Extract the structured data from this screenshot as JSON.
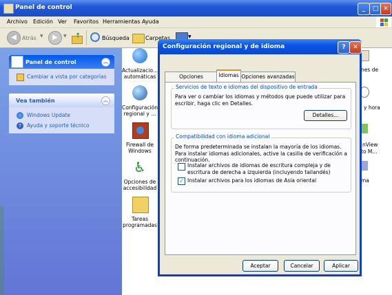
{
  "main_window": {
    "title": "Panel de control",
    "menu": [
      "Archivo",
      "Edición",
      "Ver",
      "Favoritos",
      "Herramientas",
      "Ayuda"
    ],
    "toolbar": {
      "back_label": "Atrás",
      "search_label": "Búsqueda",
      "folders_label": "Carpetas"
    }
  },
  "left_panel": {
    "control_panel_box": {
      "title": "Panel de control",
      "link": "Cambiar a vista por categorías"
    },
    "see_also_box": {
      "title": "Vea también",
      "links": [
        "Windows Update",
        "Ayuda y soporte técnico"
      ]
    }
  },
  "content_icons": [
    {
      "label": "Actualizacio... automáticas",
      "icon": "globe-update-icon"
    },
    {
      "label": "Configuración regional y ...",
      "icon": "globe-clock-icon"
    },
    {
      "label": "Firewall de Windows",
      "icon": "firewall-icon"
    },
    {
      "label": "Opciones de accesibilidad",
      "icon": "accessibility-icon"
    },
    {
      "label": "Tareas programadas",
      "icon": "scheduled-tasks-icon"
    }
  ],
  "right_partial_icons": [
    "nes de",
    "y hora",
    "nView",
    "to M...",
    "ma"
  ],
  "dialog": {
    "title": "Configuración regional y de idioma",
    "tabs": [
      "Opciones regionales",
      "Idiomas",
      "Opciones avanzadas"
    ],
    "active_tab": "Idiomas",
    "group1": {
      "title": "Servicios de texto e idiomas del dispositivo de entrada",
      "text": "Para ver o cambiar los idiomas y métodos que puede utilizar para escribir, haga clic en Detalles.",
      "button": "Detalles..."
    },
    "group2": {
      "title": "Compatibilidad con idioma adicional",
      "text": "De forma predeterminada se instalan la mayoría de los idiomas. Para instalar idiomas adicionales, active la casilla de verificación a continuación.",
      "checkboxes": [
        {
          "label": "Instalar archivos de idiomas de escritura compleja y de escritura de derecha a izquierda (incluyendo tailandés)",
          "checked": false
        },
        {
          "label": "Instalar archivos para los idiomas de Asia oriental",
          "checked": true
        }
      ]
    },
    "buttons": {
      "ok": "Aceptar",
      "cancel": "Cancelar",
      "apply": "Aplicar"
    }
  }
}
